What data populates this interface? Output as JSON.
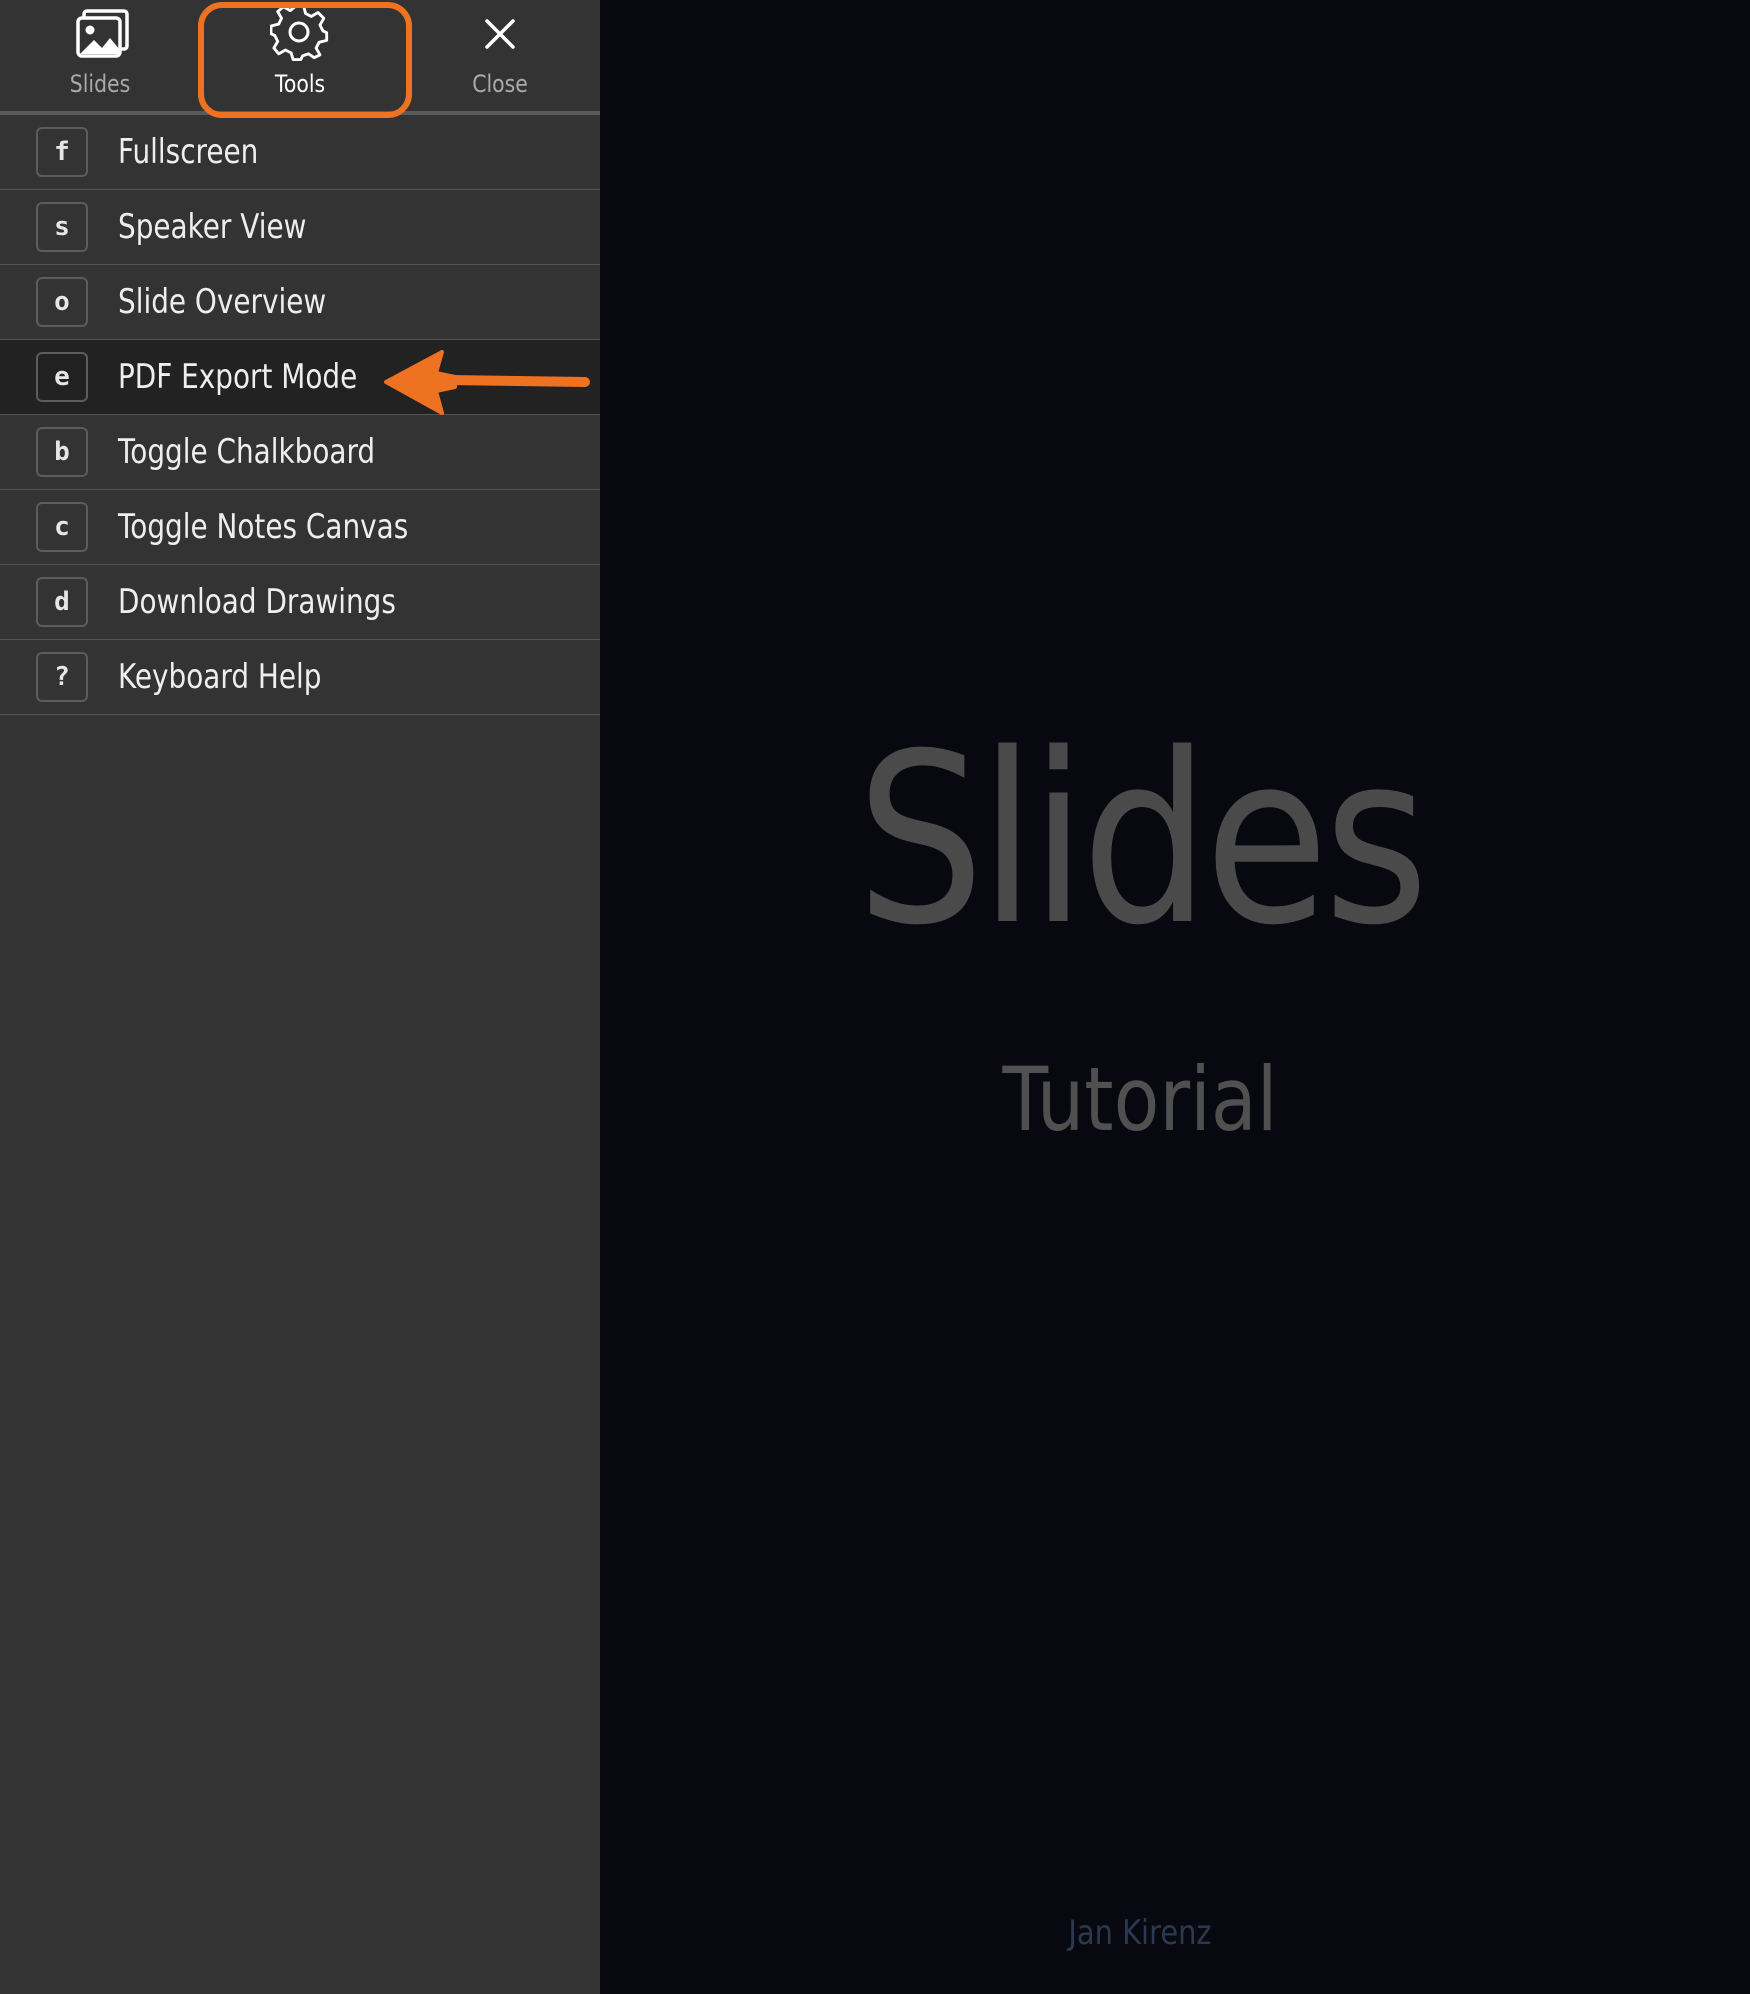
{
  "toolbar": {
    "slides_label": "Slides",
    "tools_label": "Tools",
    "close_label": "Close"
  },
  "menu": {
    "items": [
      {
        "key": "f",
        "label": "Fullscreen"
      },
      {
        "key": "s",
        "label": "Speaker View"
      },
      {
        "key": "o",
        "label": "Slide Overview"
      },
      {
        "key": "e",
        "label": "PDF Export Mode"
      },
      {
        "key": "b",
        "label": "Toggle Chalkboard"
      },
      {
        "key": "c",
        "label": "Toggle Notes Canvas"
      },
      {
        "key": "d",
        "label": "Download Drawings"
      },
      {
        "key": "?",
        "label": "Keyboard Help"
      }
    ],
    "selected_item": "PDF Export Mode"
  },
  "slide": {
    "title": "Slides",
    "subtitle": "Tutorial",
    "author": "Jan Kirenz"
  },
  "colors": {
    "menu_background": "#333333",
    "slide_background": "#070810",
    "annotation_orange": "#ee7222",
    "slide_title": "#4a4a4a"
  },
  "icons": {
    "slides": "image-icon",
    "tools": "gear-icon",
    "close": "close-icon"
  }
}
